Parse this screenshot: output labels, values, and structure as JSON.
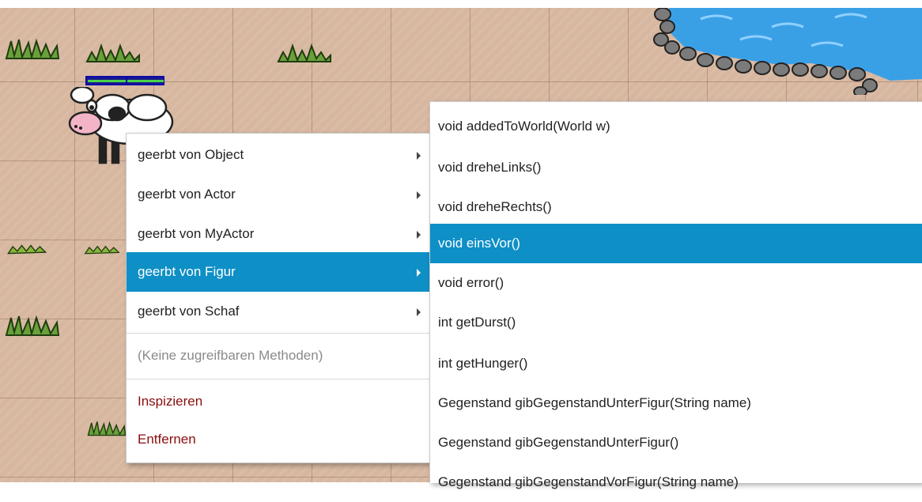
{
  "context_menu": {
    "items": [
      {
        "label": "geerbt von Object",
        "has_submenu": true
      },
      {
        "label": "geerbt von Actor",
        "has_submenu": true
      },
      {
        "label": "geerbt von MyActor",
        "has_submenu": true
      },
      {
        "label": "geerbt von Figur",
        "has_submenu": true,
        "selected": true
      },
      {
        "label": "geerbt von Schaf",
        "has_submenu": true
      }
    ],
    "no_methods_label": "(Keine zugreifbaren Methoden)",
    "inspect_label": "Inspizieren",
    "remove_label": "Entfernen"
  },
  "submenu": {
    "items": [
      {
        "label": "void addedToWorld(World w)"
      },
      {
        "label": "void dreheLinks()"
      },
      {
        "label": "void dreheRechts()"
      },
      {
        "label": "void einsVor()",
        "selected": true
      },
      {
        "label": "void error()"
      },
      {
        "label": "int getDurst()"
      },
      {
        "label": "int getHunger()"
      },
      {
        "label": "Gegenstand gibGegenstandUnterFigur(String name)"
      },
      {
        "label": "Gegenstand gibGegenstandUnterFigur()"
      },
      {
        "label": "Gegenstand gibGegenstandVorFigur(String name)"
      }
    ]
  },
  "colors": {
    "selection": "#0e8fc6",
    "danger_text": "#8b0d0d",
    "ground": "#d7b7a0",
    "water": "#3aa0e6"
  }
}
